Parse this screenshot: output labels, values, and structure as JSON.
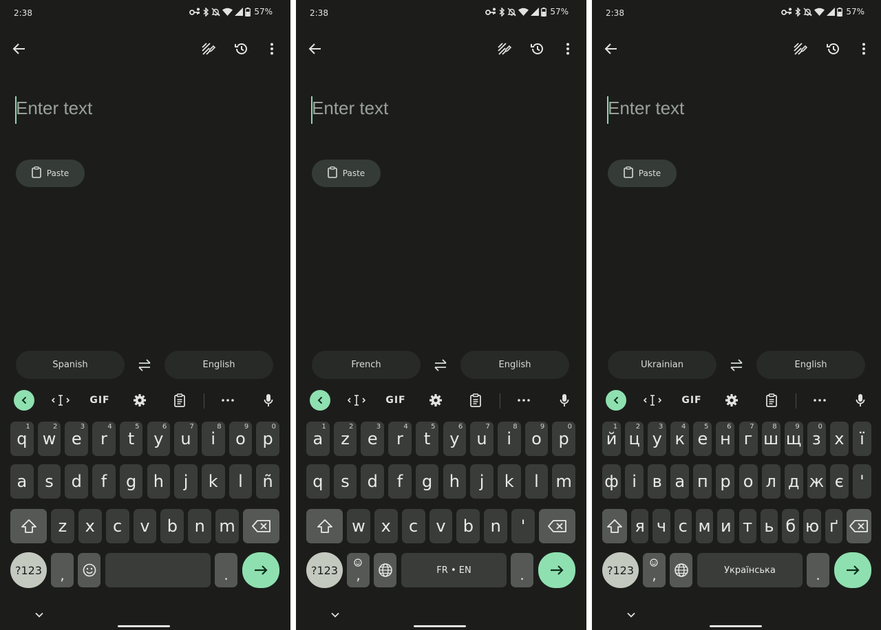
{
  "status": {
    "time": "2:38",
    "battery": "57%"
  },
  "editor": {
    "placeholder": "Enter text"
  },
  "paste_label": "Paste",
  "toolbar": {
    "gif": "GIF"
  },
  "phones": [
    {
      "source_lang": "Spanish",
      "target_lang": "English",
      "rows": [
        [
          {
            "k": "q",
            "h": "1"
          },
          {
            "k": "w",
            "h": "2"
          },
          {
            "k": "e",
            "h": "3"
          },
          {
            "k": "r",
            "h": "4"
          },
          {
            "k": "t",
            "h": "5"
          },
          {
            "k": "y",
            "h": "6"
          },
          {
            "k": "u",
            "h": "7"
          },
          {
            "k": "i",
            "h": "8"
          },
          {
            "k": "o",
            "h": "9"
          },
          {
            "k": "p",
            "h": "0"
          }
        ],
        [
          {
            "k": "a"
          },
          {
            "k": "s"
          },
          {
            "k": "d"
          },
          {
            "k": "f"
          },
          {
            "k": "g"
          },
          {
            "k": "h"
          },
          {
            "k": "j"
          },
          {
            "k": "k"
          },
          {
            "k": "l"
          },
          {
            "k": "ñ"
          }
        ],
        [
          {
            "k": "z"
          },
          {
            "k": "x"
          },
          {
            "k": "c"
          },
          {
            "k": "v"
          },
          {
            "k": "b"
          },
          {
            "k": "n"
          },
          {
            "k": "m"
          }
        ]
      ],
      "sym_label": "?123",
      "comma": ",",
      "period": ".",
      "space_label": ""
    },
    {
      "source_lang": "French",
      "target_lang": "English",
      "rows": [
        [
          {
            "k": "a",
            "h": "1"
          },
          {
            "k": "z",
            "h": "2"
          },
          {
            "k": "e",
            "h": "3"
          },
          {
            "k": "r",
            "h": "4"
          },
          {
            "k": "t",
            "h": "5"
          },
          {
            "k": "y",
            "h": "6"
          },
          {
            "k": "u",
            "h": "7"
          },
          {
            "k": "i",
            "h": "8"
          },
          {
            "k": "o",
            "h": "9"
          },
          {
            "k": "p",
            "h": "0"
          }
        ],
        [
          {
            "k": "q"
          },
          {
            "k": "s"
          },
          {
            "k": "d"
          },
          {
            "k": "f"
          },
          {
            "k": "g"
          },
          {
            "k": "h"
          },
          {
            "k": "j"
          },
          {
            "k": "k"
          },
          {
            "k": "l"
          },
          {
            "k": "m"
          }
        ],
        [
          {
            "k": "w"
          },
          {
            "k": "x"
          },
          {
            "k": "c"
          },
          {
            "k": "v"
          },
          {
            "k": "b"
          },
          {
            "k": "n"
          },
          {
            "k": "'"
          }
        ]
      ],
      "sym_label": "?123",
      "comma": ",",
      "period": ".",
      "space_label": "FR • EN"
    },
    {
      "source_lang": "Ukrainian",
      "target_lang": "English",
      "rows": [
        [
          {
            "k": "й",
            "h": "1"
          },
          {
            "k": "ц",
            "h": "2"
          },
          {
            "k": "у",
            "h": "3"
          },
          {
            "k": "к",
            "h": "4"
          },
          {
            "k": "е",
            "h": "5"
          },
          {
            "k": "н",
            "h": "6"
          },
          {
            "k": "г",
            "h": "7"
          },
          {
            "k": "ш",
            "h": "8"
          },
          {
            "k": "щ",
            "h": "9"
          },
          {
            "k": "з",
            "h": "0"
          },
          {
            "k": "х"
          },
          {
            "k": "ї"
          }
        ],
        [
          {
            "k": "ф"
          },
          {
            "k": "і"
          },
          {
            "k": "в"
          },
          {
            "k": "а"
          },
          {
            "k": "п"
          },
          {
            "k": "р"
          },
          {
            "k": "о"
          },
          {
            "k": "л"
          },
          {
            "k": "д"
          },
          {
            "k": "ж"
          },
          {
            "k": "є"
          },
          {
            "k": "'"
          }
        ],
        [
          {
            "k": "я"
          },
          {
            "k": "ч"
          },
          {
            "k": "с"
          },
          {
            "k": "м"
          },
          {
            "k": "и"
          },
          {
            "k": "т"
          },
          {
            "k": "ь"
          },
          {
            "k": "б"
          },
          {
            "k": "ю"
          },
          {
            "k": "ґ"
          }
        ]
      ],
      "sym_label": "?123",
      "comma": ",",
      "period": ".",
      "space_label": "Українська"
    }
  ]
}
